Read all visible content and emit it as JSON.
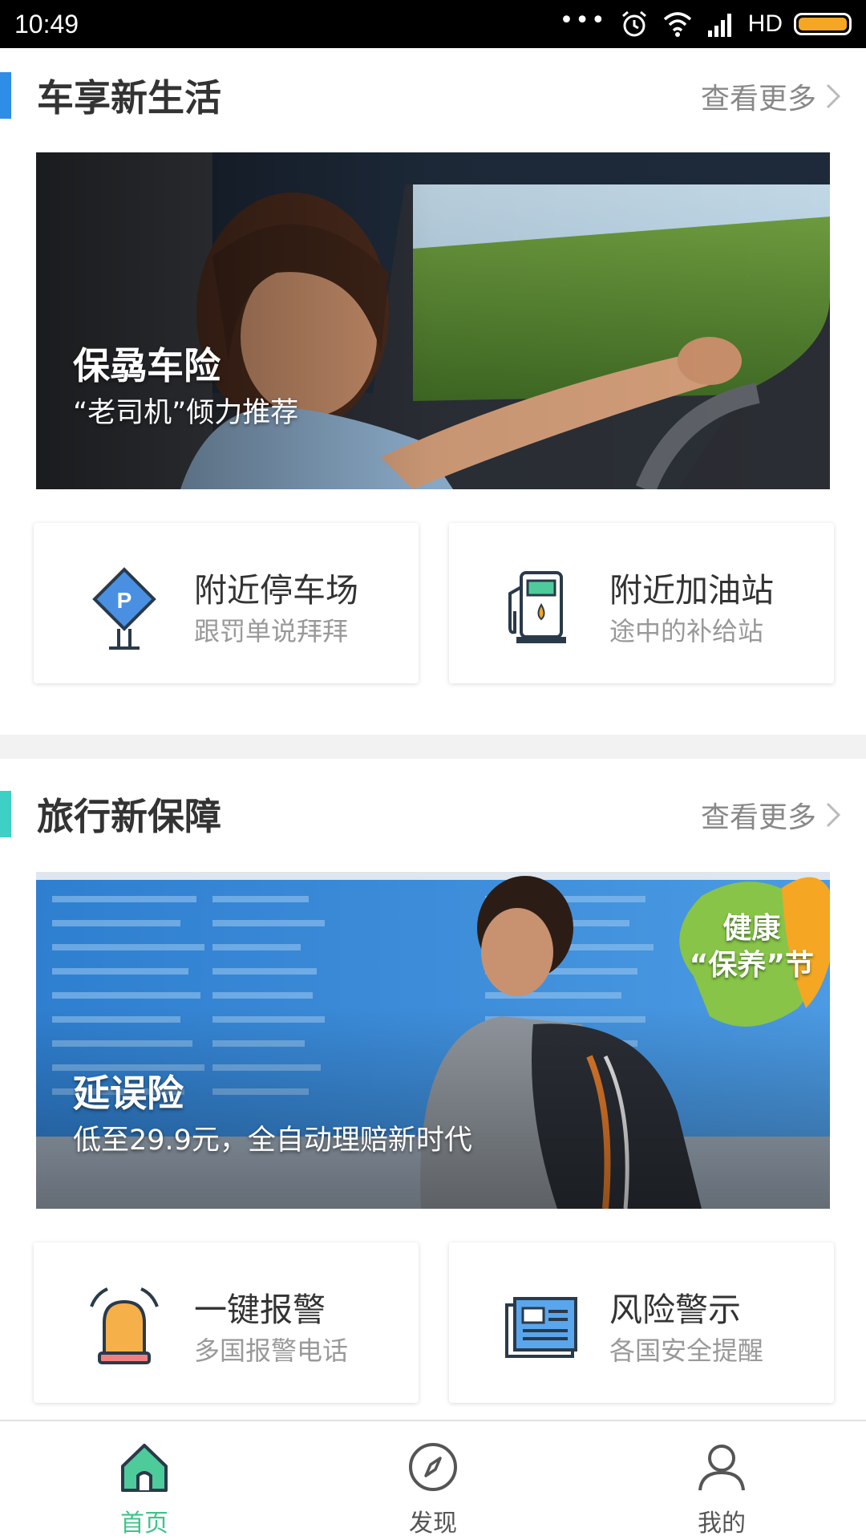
{
  "status_bar": {
    "time": "10:49",
    "network": "HD",
    "colors": {
      "battery": "#f5a623"
    }
  },
  "section1": {
    "title": "车享新生活",
    "more_label": "查看更多",
    "accent_color": "#2e8de6",
    "banner": {
      "title": "保骉车险",
      "subtitle": "“老司机”倾力推荐"
    },
    "cards": [
      {
        "title": "附近停车场",
        "subtitle": "跟罚单说拜拜",
        "icon": "parking-sign-icon"
      },
      {
        "title": "附近加油站",
        "subtitle": "途中的补给站",
        "icon": "gas-pump-icon"
      }
    ]
  },
  "section2": {
    "title": "旅行新保障",
    "more_label": "查看更多",
    "accent_color": "#3ed0c4",
    "banner": {
      "title": "延误险",
      "subtitle": "低至29.9元，全自动理赔新时代",
      "badge_line1": "健康",
      "badge_line2": "“保养”节"
    },
    "cards": [
      {
        "title": "一键报警",
        "subtitle": "多国报警电话",
        "icon": "alarm-siren-icon"
      },
      {
        "title": "风险警示",
        "subtitle": "各国安全提醒",
        "icon": "newspaper-icon"
      }
    ]
  },
  "bottom_nav": {
    "active_color": "#3ec48a",
    "items": [
      {
        "label": "首页",
        "icon": "home-icon",
        "active": true
      },
      {
        "label": "发现",
        "icon": "compass-icon",
        "active": false
      },
      {
        "label": "我的",
        "icon": "user-icon",
        "active": false
      }
    ]
  }
}
